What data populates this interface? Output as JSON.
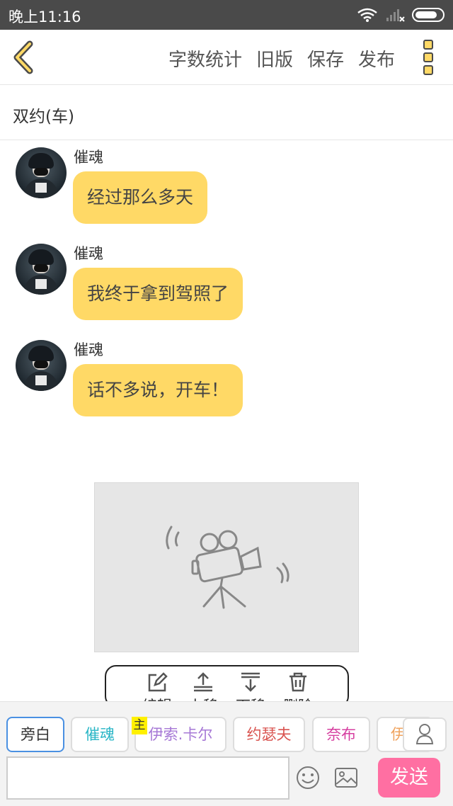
{
  "status_bar": {
    "time": "晚上11:16"
  },
  "header": {
    "actions": [
      "字数统计",
      "旧版",
      "保存",
      "发布"
    ]
  },
  "document": {
    "title": "双约(车)"
  },
  "messages": [
    {
      "sender": "催魂",
      "text": "经过那么多天"
    },
    {
      "sender": "催魂",
      "text": "我终于拿到驾照了"
    },
    {
      "sender": "催魂",
      "text": "话不多说，开车！"
    }
  ],
  "edit_toolbar": {
    "items": [
      "编辑",
      "上移",
      "下移",
      "删除"
    ]
  },
  "characters": [
    {
      "name": "旁白",
      "color": "#333333",
      "selected": true
    },
    {
      "name": "催魂",
      "color": "#29b6c6"
    },
    {
      "name": "伊索.卡尔",
      "color": "#a678d6",
      "badge": "主"
    },
    {
      "name": "约瑟夫",
      "color": "#d9534f"
    },
    {
      "name": "奈布",
      "color": "#d63fa0"
    },
    {
      "name": "伊",
      "color": "#f0a35e"
    }
  ],
  "composer": {
    "placeholder": "",
    "send_label": "发送"
  },
  "icons": {
    "back": "back-chevron-icon",
    "more": "more-menu-icon",
    "video": "video-camera-icon",
    "emoji": "emoji-icon",
    "image": "image-icon",
    "person": "person-icon"
  },
  "colors": {
    "accent": "#ffd966",
    "send": "#ff6fa2",
    "selected_border": "#4a90e2"
  }
}
